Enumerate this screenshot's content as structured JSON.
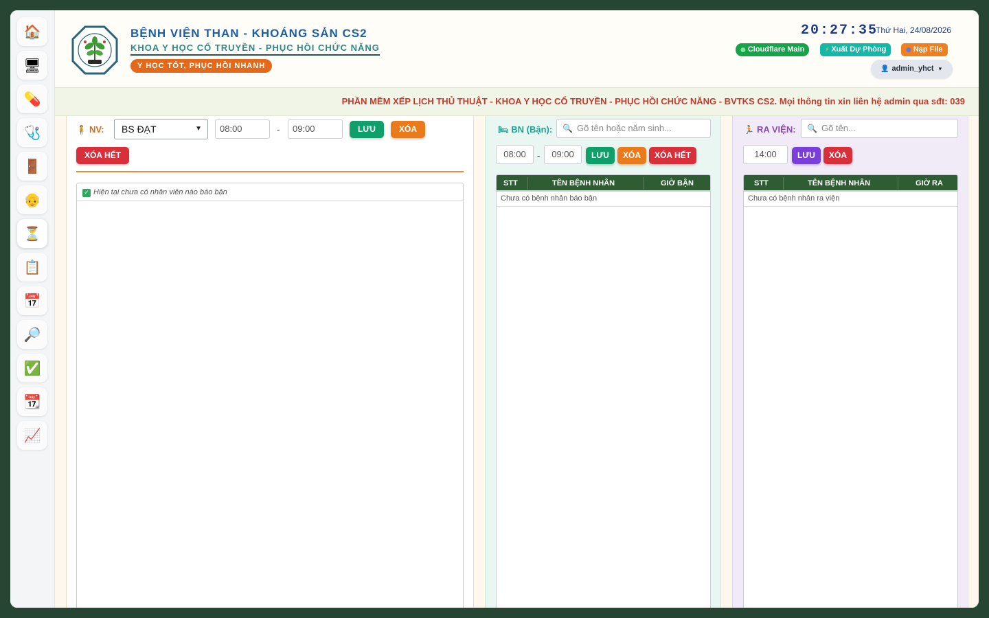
{
  "sidebar": {
    "items": [
      {
        "icon": "🏠",
        "name": "home-icon"
      },
      {
        "icon": "🖥",
        "name": "monitor-icon"
      },
      {
        "icon": "💊",
        "name": "pill-icon"
      },
      {
        "icon": "🩺",
        "name": "stethoscope-icon"
      },
      {
        "icon": "🚪",
        "name": "door-icon"
      },
      {
        "icon": "👴",
        "name": "elderly-person-icon"
      },
      {
        "icon": "⏳",
        "name": "hourglass-icon"
      },
      {
        "icon": "📋",
        "name": "clipboard-icon"
      },
      {
        "icon": "📅",
        "name": "calendar-icon"
      },
      {
        "icon": "🔎",
        "name": "magnifier-icon"
      },
      {
        "icon": "✅",
        "name": "checkbox-icon"
      },
      {
        "icon": "📆",
        "name": "calendar-grid-icon"
      },
      {
        "icon": "📈",
        "name": "chart-up-icon"
      }
    ],
    "active_index": 6
  },
  "header": {
    "hospital_name": "BỆNH VIỆN THAN - KHOÁNG SẢN CS2",
    "department": "KHOA Y HỌC CỔ TRUYỀN - PHỤC HỒI CHỨC NĂNG",
    "slogan": "Y HỌC TỐT, PHỤC HỒI NHANH",
    "clock": "20:27:35",
    "date": "Thứ Hai, 24/08/2026",
    "buttons": [
      {
        "label": "Cloudflare Main",
        "icon": "●",
        "color": "#16a34a"
      },
      {
        "label": "Xuất Dự Phòng",
        "icon": "⚡",
        "color": "#14b8a6"
      },
      {
        "label": "Nạp File",
        "icon": "●",
        "color": "#f07f1f"
      }
    ],
    "user": {
      "name": "admin_yhct",
      "icon": "👤",
      "caret": "▾"
    }
  },
  "marquee": "PHẦN MỀM XẾP LỊCH THỦ THUẬT - KHOA Y HỌC CỔ TRUYỀN - PHỤC HỒI CHỨC NĂNG - BVTKS CS2. Mọi thông tin xin liên hệ admin qua sđt: 039",
  "staff_panel": {
    "label": "NV:",
    "label_icon": "🧍",
    "label_color": "#d2691e",
    "selected_staff": "BS ĐẠT",
    "time_from": "08:00",
    "time_sep": "-",
    "time_to": "09:00",
    "save_label": "LƯU",
    "delete_label": "XÓA",
    "delete_all_label": "XÓA HẾT",
    "empty_message": "Hiện tại chưa có nhân viên nào báo bận",
    "check_icon": "✓"
  },
  "busy_patient_panel": {
    "label": "BN (Bận):",
    "label_icon": "🛏",
    "label_color": "#1aa392",
    "search_placeholder": "Gõ tên hoặc năm sinh...",
    "search_icon": "🔍",
    "time_from": "08:00",
    "time_sep": "-",
    "time_to": "09:00",
    "save_label": "LƯU",
    "delete_label": "XÓA",
    "delete_all_label": "XÓA HẾT",
    "columns": [
      "STT",
      "TÊN BỆNH NHÂN",
      "GIỜ BẬN"
    ],
    "empty_message": "Chưa có bệnh nhân báo bận"
  },
  "discharge_panel": {
    "label": "RA VIỆN:",
    "label_icon": "🏃",
    "label_color": "#8a4ab8",
    "search_placeholder": "Gõ tên...",
    "search_icon": "🔍",
    "time": "14:00",
    "save_label": "LƯU",
    "delete_label": "XÓA",
    "columns": [
      "STT",
      "TÊN BỆNH NHÂN",
      "GIỜ RA"
    ],
    "empty_message": "Chưa có bệnh nhân ra viện"
  }
}
